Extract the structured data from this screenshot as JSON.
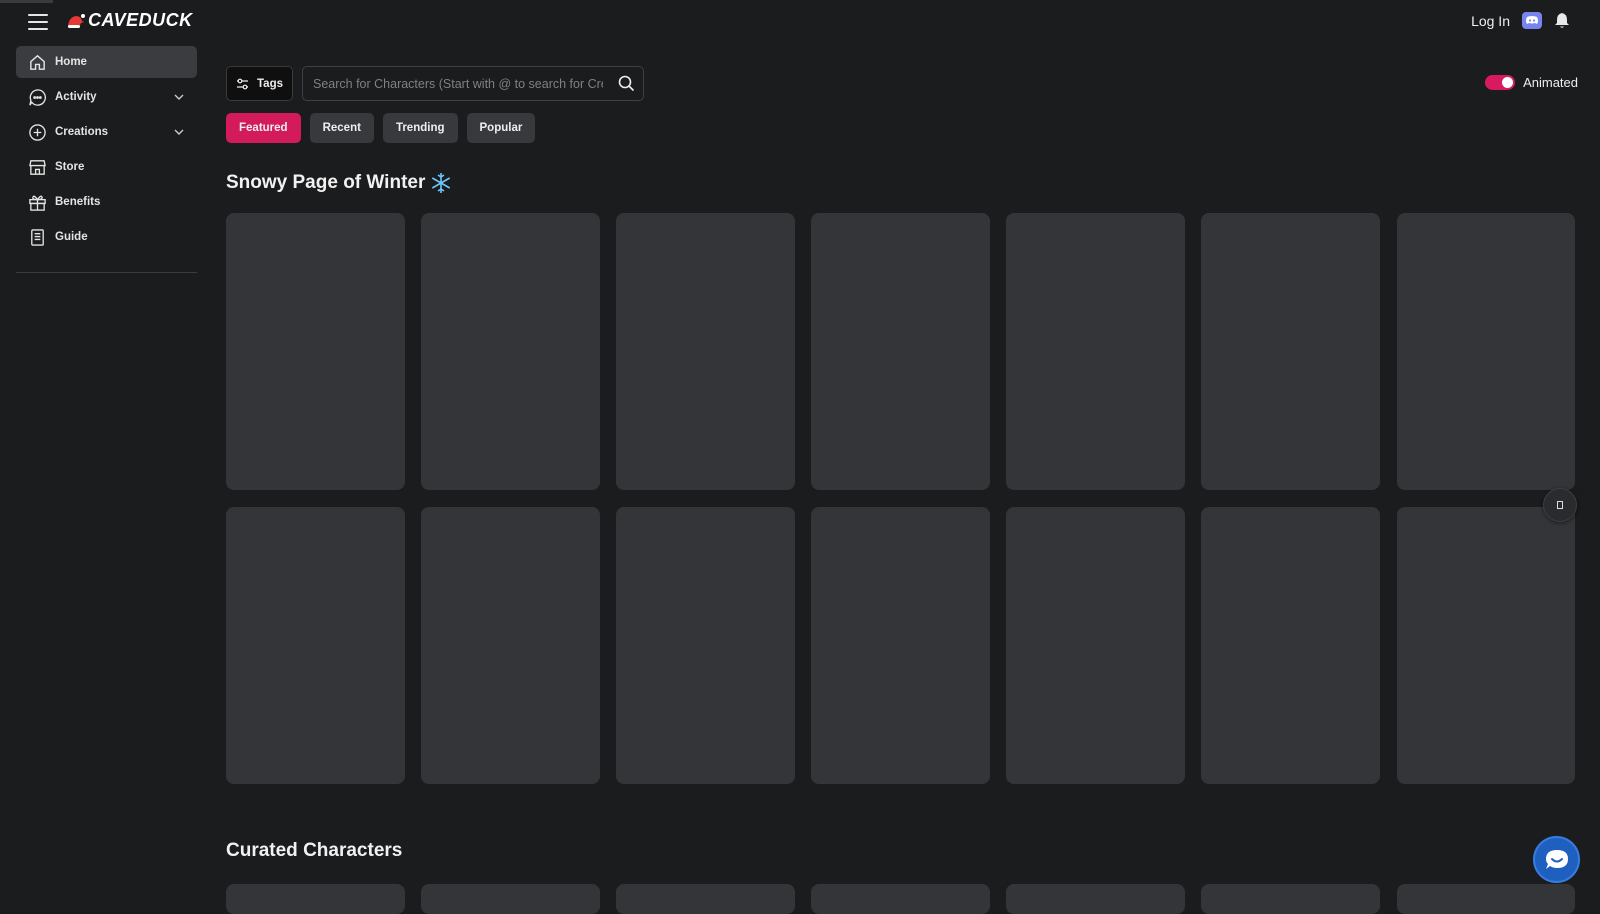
{
  "header": {
    "brand": "CAVEDUCK",
    "login_label": "Log In",
    "icons": [
      "menu-icon",
      "discord-icon",
      "bell-icon"
    ]
  },
  "sidebar": {
    "items": [
      {
        "label": "Home",
        "icon": "home-icon",
        "active": true
      },
      {
        "label": "Activity",
        "icon": "chat-bubble-icon",
        "expandable": true
      },
      {
        "label": "Creations",
        "icon": "plus-circle-icon",
        "expandable": true
      },
      {
        "label": "Store",
        "icon": "store-icon"
      },
      {
        "label": "Benefits",
        "icon": "gift-icon"
      },
      {
        "label": "Guide",
        "icon": "guide-icon"
      }
    ]
  },
  "toolbar": {
    "tags_label": "Tags",
    "search_placeholder": "Search for Characters (Start with @ to search for Creators)",
    "animated_label": "Animated",
    "animated_on": true
  },
  "tabs": [
    {
      "label": "Featured",
      "active": true
    },
    {
      "label": "Recent"
    },
    {
      "label": "Trending"
    },
    {
      "label": "Popular"
    }
  ],
  "sections": [
    {
      "title": "Snowy Page of Winter",
      "emoji": "❄️",
      "card_count": 14
    },
    {
      "title": "Curated Characters",
      "card_count": 7
    }
  ],
  "colors": {
    "background": "#1b1c1d",
    "card": "#343538",
    "accent": "#d31b5c",
    "chat_button": "#1f5fbf",
    "discord": "#7784ee"
  }
}
